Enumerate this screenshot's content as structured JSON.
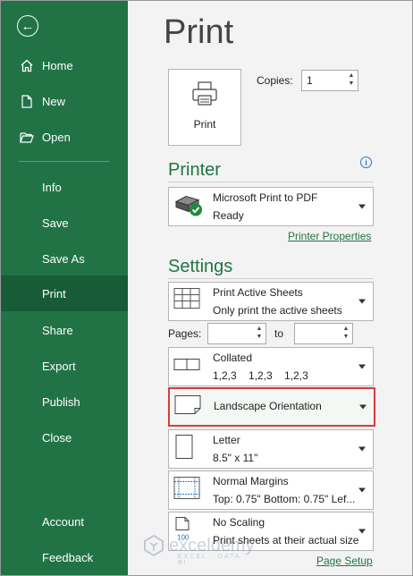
{
  "sidebar": {
    "back": "←",
    "items": [
      {
        "label": "Home",
        "icon": "home-icon"
      },
      {
        "label": "New",
        "icon": "new-document-icon"
      },
      {
        "label": "Open",
        "icon": "folder-icon"
      },
      {
        "label": "Info"
      },
      {
        "label": "Save"
      },
      {
        "label": "Save As"
      },
      {
        "label": "Print",
        "active": true
      },
      {
        "label": "Share"
      },
      {
        "label": "Export"
      },
      {
        "label": "Publish"
      },
      {
        "label": "Close"
      },
      {
        "label": "Account"
      },
      {
        "label": "Feedback"
      }
    ]
  },
  "main": {
    "title": "Print",
    "print_button": "Print",
    "copies_label": "Copies:",
    "copies_value": "1",
    "printer_section": "Printer",
    "printer": {
      "name": "Microsoft Print to PDF",
      "status": "Ready"
    },
    "printer_properties": "Printer Properties",
    "settings_section": "Settings",
    "sheets": {
      "line1": "Print Active Sheets",
      "line2": "Only print the active sheets"
    },
    "pages_label": "Pages:",
    "to_label": "to",
    "collate": {
      "line1": "Collated",
      "line2": "1,2,3    1,2,3    1,2,3"
    },
    "orientation": "Landscape Orientation",
    "paper": {
      "line1": "Letter",
      "line2": "8.5\" x 11\""
    },
    "margins": {
      "line1": "Normal Margins",
      "line2": "Top: 0.75\" Bottom: 0.75\" Lef..."
    },
    "scaling": {
      "line1": "No Scaling",
      "line2": "Print sheets at their actual size"
    },
    "page_setup": "Page Setup"
  },
  "watermark": {
    "text": "exceldemy",
    "subtext": "EXCEL · DATA · BI"
  },
  "colors": {
    "accent": "#217346",
    "active_nav": "#185c37",
    "highlight_border": "#d83b3b"
  }
}
